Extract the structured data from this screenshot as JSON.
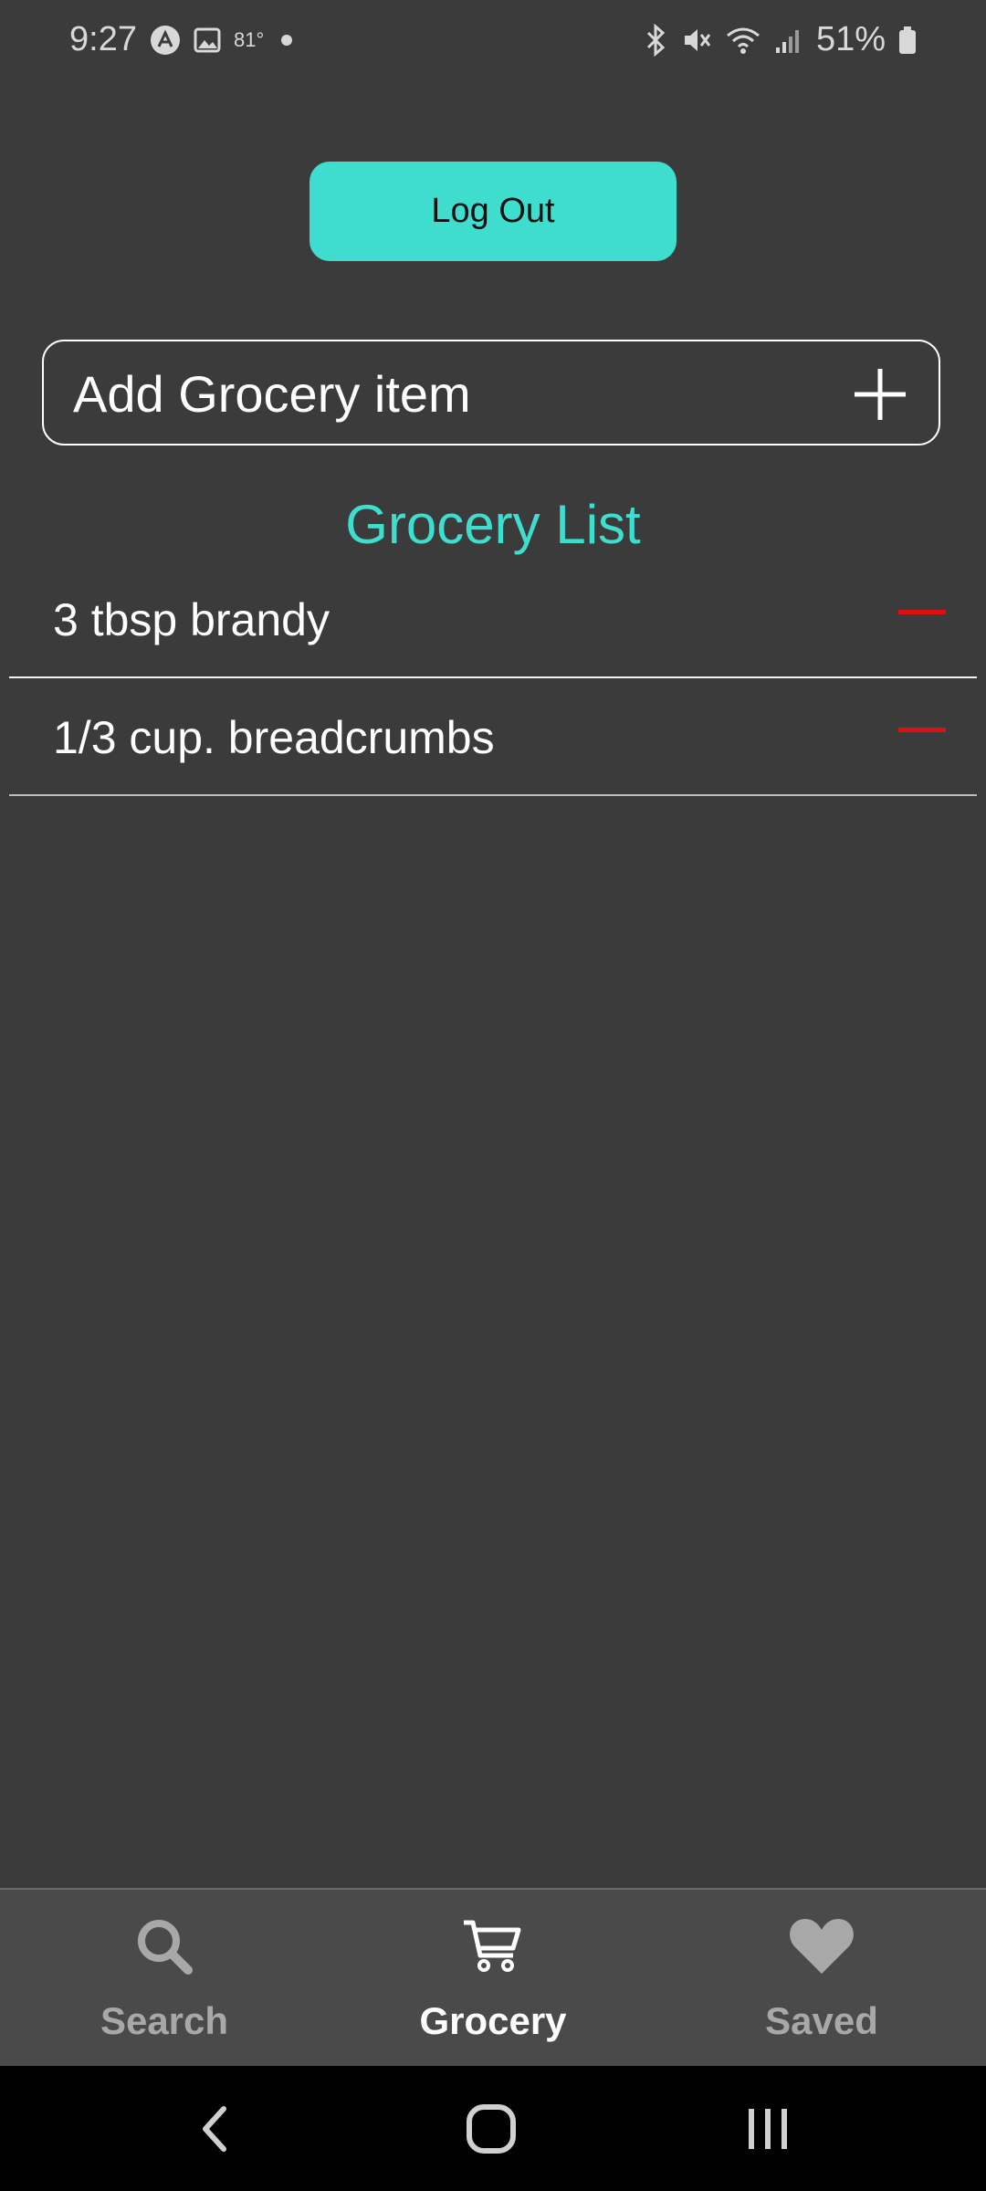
{
  "status_bar": {
    "time": "9:27",
    "temperature": "81°",
    "battery": "51%",
    "icons_left": [
      "app-notification-icon",
      "image-icon",
      "dot-icon"
    ],
    "icons_right": [
      "bluetooth-icon",
      "mute-icon",
      "wifi-icon",
      "signal-icon",
      "battery-icon"
    ]
  },
  "header": {
    "logout_label": "Log Out"
  },
  "add_item": {
    "placeholder": "Add Grocery item",
    "button_icon": "plus-icon"
  },
  "grocery": {
    "title": "Grocery List",
    "items": [
      {
        "label": "3 tbsp brandy"
      },
      {
        "label": "1/3 cup. breadcrumbs"
      }
    ]
  },
  "tabs": [
    {
      "label": "Search",
      "icon": "search-icon",
      "active": false
    },
    {
      "label": "Grocery",
      "icon": "cart-icon",
      "active": true
    },
    {
      "label": "Saved",
      "icon": "heart-icon",
      "active": false
    }
  ],
  "colors": {
    "background": "#3b3b3b",
    "accent": "#3fddce",
    "remove": "#e10f0f",
    "tab_bar": "#4a4a4a"
  }
}
